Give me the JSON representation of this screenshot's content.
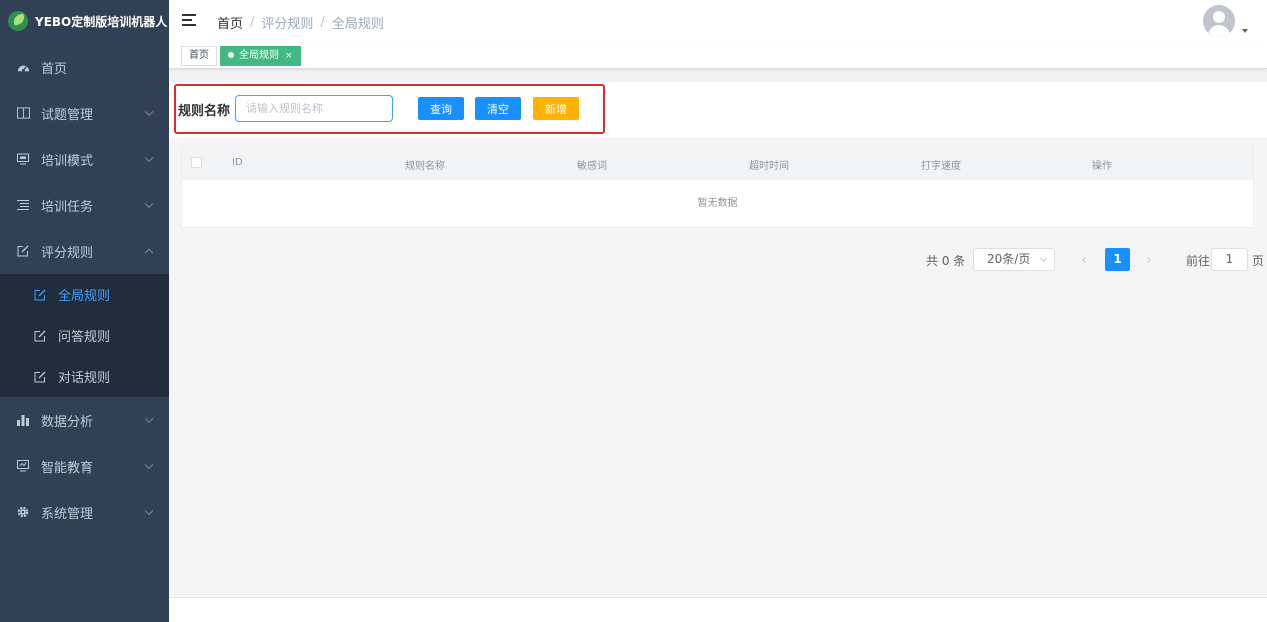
{
  "app": {
    "title": "YEBO定制版培训机器人"
  },
  "sidebar": {
    "items": [
      {
        "label": "首页",
        "icon": "dashboard-icon"
      },
      {
        "label": "试题管理",
        "icon": "book-icon"
      },
      {
        "label": "培训模式",
        "icon": "monitor-icon"
      },
      {
        "label": "培训任务",
        "icon": "list-icon"
      },
      {
        "label": "评分规则",
        "icon": "edit-icon"
      },
      {
        "label": "数据分析",
        "icon": "chart-icon"
      },
      {
        "label": "智能教育",
        "icon": "education-icon"
      },
      {
        "label": "系统管理",
        "icon": "gear-icon"
      }
    ],
    "submenu": [
      {
        "label": "全局规则",
        "active": true
      },
      {
        "label": "问答规则",
        "active": false
      },
      {
        "label": "对话规则",
        "active": false
      }
    ]
  },
  "navbar": {
    "breadcrumb": [
      "首页",
      "评分规则",
      "全局规则"
    ],
    "separator": "/"
  },
  "tags": [
    {
      "label": "首页",
      "active": false
    },
    {
      "label": "全局规则",
      "active": true,
      "close": "×"
    }
  ],
  "search": {
    "label": "规则名称",
    "placeholder": "请输入规则名称",
    "query_label": "查询",
    "clear_label": "清空",
    "add_label": "新增"
  },
  "table": {
    "columns": [
      "ID",
      "规则名称",
      "敏感词",
      "超时时间",
      "打字速度",
      "操作"
    ],
    "empty_text": "暂无数据"
  },
  "pagination": {
    "total_text": "共 0 条",
    "page_size": "20条/页",
    "current_page": "1",
    "goto_label": "前往",
    "goto_value": "1",
    "page_suffix": "页",
    "prev": "‹",
    "next": "›"
  },
  "colors": {
    "sidebar_bg": "#304156",
    "submenu_bg": "#1f2d3d",
    "accent_blue": "#1890ff",
    "accent_green": "#42b983",
    "accent_yellow": "#ffb300",
    "highlight_red": "#e0292c"
  }
}
